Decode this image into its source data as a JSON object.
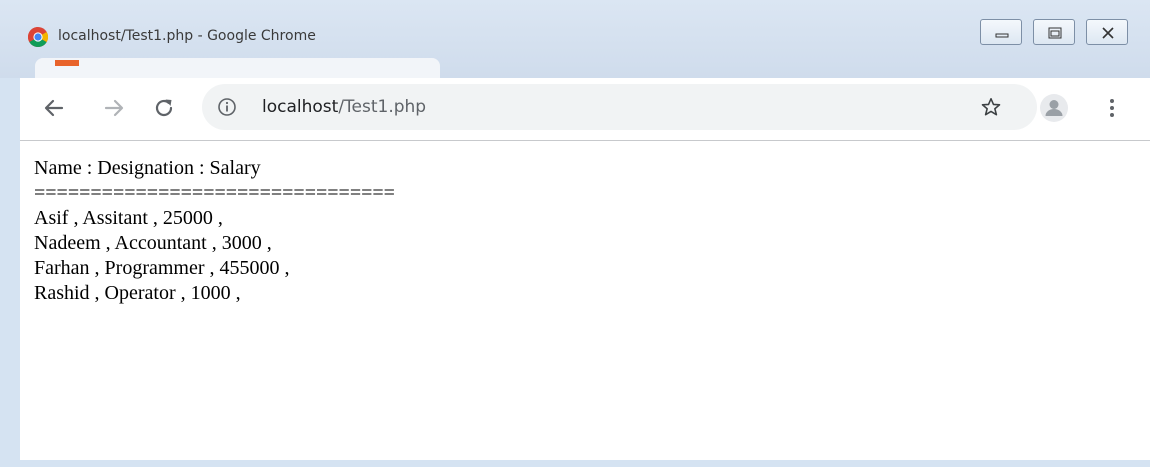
{
  "window": {
    "title": "localhost/Test1.php - Google Chrome"
  },
  "toolbar": {
    "url_host": "localhost",
    "url_path": "/Test1.php"
  },
  "page": {
    "lines": [
      "Name : Designation : Salary",
      "================================",
      "Asif , Assitant , 25000 ,",
      "Nadeem , Accountant , 3000 ,",
      "Farhan , Programmer , 455000 ,",
      "Rashid , Operator , 1000 ,"
    ]
  },
  "icons": {
    "app": "chrome-logo-icon",
    "back": "back-arrow-icon",
    "forward": "forward-arrow-icon",
    "reload": "reload-icon",
    "info": "info-icon",
    "bookmark": "star-icon",
    "profile": "avatar-icon",
    "menu": "kebab-menu-icon"
  },
  "colors": {
    "title_bar": "#cfdcec",
    "omnibox": "#f1f3f4",
    "page_background": "#ffffff"
  }
}
